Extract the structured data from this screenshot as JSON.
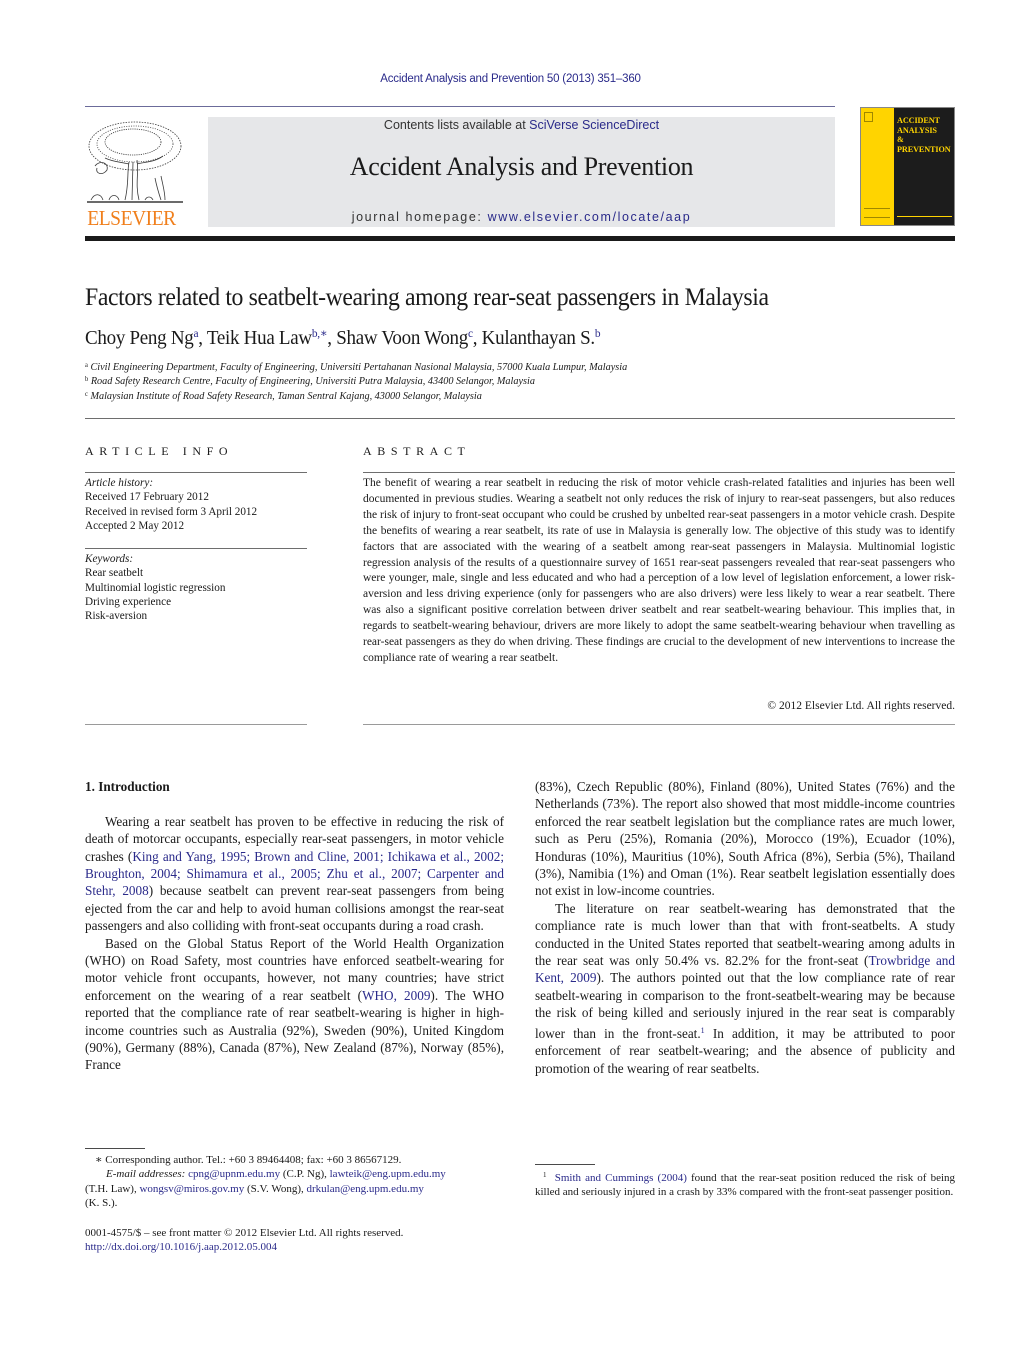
{
  "running_head": "Accident Analysis and Prevention 50 (2013) 351–360",
  "masthead": {
    "publisher_word": "ELSEVIER",
    "contents_prefix": "Contents lists available at ",
    "contents_link": "SciVerse ScienceDirect",
    "journal_title": "Accident Analysis and Prevention",
    "homepage_prefix": "journal homepage: ",
    "homepage_link": "www.elsevier.com/locate/aap",
    "cover_title_lines": [
      "ACCIDENT",
      "ANALYSIS",
      "&",
      "PREVENTION"
    ],
    "colors": {
      "elsevier_orange": "#f07f1c",
      "cover_yellow": "#ffd400",
      "cover_dark": "#1c1c1c",
      "banner_gray": "#e6e7e9",
      "link_blue": "#2a2a8a"
    }
  },
  "article": {
    "title": "Factors related to seatbelt-wearing among rear-seat passengers in Malaysia",
    "authors": [
      {
        "name": "Choy Peng Ng",
        "sup": "a"
      },
      {
        "name": "Teik Hua Law",
        "sup": "b,∗"
      },
      {
        "name": "Shaw Voon Wong",
        "sup": "c"
      },
      {
        "name": "Kulanthayan S.",
        "sup": "b"
      }
    ],
    "affiliations": [
      {
        "key": "a",
        "text": "Civil Engineering Department, Faculty of Engineering, Universiti Pertahanan Nasional Malaysia, 57000 Kuala Lumpur, Malaysia"
      },
      {
        "key": "b",
        "text": "Road Safety Research Centre, Faculty of Engineering, Universiti Putra Malaysia, 43400 Selangor, Malaysia"
      },
      {
        "key": "c",
        "text": "Malaysian Institute of Road Safety Research, Taman Sentral Kajang, 43000 Selangor, Malaysia"
      }
    ]
  },
  "article_info": {
    "heading": "ARTICLE INFO",
    "history_label": "Article history:",
    "history": [
      "Received 17 February 2012",
      "Received in revised form 3 April 2012",
      "Accepted 2 May 2012"
    ],
    "keywords_label": "Keywords:",
    "keywords": [
      "Rear seatbelt",
      "Multinomial logistic regression",
      "Driving experience",
      "Risk-aversion"
    ]
  },
  "abstract": {
    "heading": "ABSTRACT",
    "text": "The benefit of wearing a rear seatbelt in reducing the risk of motor vehicle crash-related fatalities and injuries has been well documented in previous studies. Wearing a seatbelt not only reduces the risk of injury to rear-seat passengers, but also reduces the risk of injury to front-seat occupant who could be crushed by unbelted rear-seat passengers in a motor vehicle crash. Despite the benefits of wearing a rear seatbelt, its rate of use in Malaysia is generally low. The objective of this study was to identify factors that are associated with the wearing of a seatbelt among rear-seat passengers in Malaysia. Multinomial logistic regression analysis of the results of a questionnaire survey of 1651 rear-seat passengers revealed that rear-seat passengers who were younger, male, single and less educated and who had a perception of a low level of legislation enforcement, a lower risk-aversion and less driving experience (only for passengers who are also drivers) were less likely to wear a rear seatbelt. There was also a significant positive correlation between driver seatbelt and rear seatbelt-wearing behaviour. This implies that, in regards to seatbelt-wearing behaviour, drivers are more likely to adopt the same seatbelt-wearing behaviour when travelling as rear-seat passengers as they do when driving. These findings are crucial to the development of new interventions to increase the compliance rate of wearing a rear seatbelt.",
    "copyright": "© 2012 Elsevier Ltd. All rights reserved."
  },
  "body": {
    "section_heading": "1.  Introduction",
    "p1_a": "Wearing a rear seatbelt has proven to be effective in reducing the risk of death of motorcar occupants, especially rear-seat passengers, in motor vehicle crashes (",
    "p1_cite": "King and Yang, 1995; Brown and Cline, 2001; Ichikawa et al., 2002; Broughton, 2004; Shimamura et al., 2005; Zhu et al., 2007; Carpenter and Stehr, 2008",
    "p1_b": ") because seatbelt can prevent rear-seat passengers from being ejected from the car and help to avoid human collisions amongst the rear-seat passengers and also colliding with front-seat occupants during a road crash.",
    "p2_a": "Based on the Global Status Report of the World Health Organization (WHO) on Road Safety, most countries have enforced seatbelt-wearing for motor vehicle front occupants, however, not many countries; have strict enforcement on the wearing of a rear seatbelt (",
    "p2_cite": "WHO, 2009",
    "p2_b": "). The WHO reported that the compliance rate of rear seatbelt-wearing is higher in high-income countries such as Australia (92%), Sweden (90%), United Kingdom (90%), Germany (88%), Canada (87%), New Zealand (87%), Norway (85%), France",
    "p2_cont": "(83%), Czech Republic (80%), Finland (80%), United States (76%) and the Netherlands (73%). The report also showed that most middle-income countries enforced the rear seatbelt legislation but the compliance rates are much lower, such as Peru (25%), Romania (20%), Morocco (19%), Ecuador (10%), Honduras (10%), Mauritius (10%), South Africa (8%), Serbia (5%), Thailand (3%), Namibia (1%) and Oman (1%). Rear seatbelt legislation essentially does not exist in low-income countries.",
    "p3_a": "The literature on rear seatbelt-wearing has demonstrated that the compliance rate is much lower than that with front-seatbelts. A study conducted in the United States reported that seatbelt-wearing among adults in the rear seat was only 50.4% vs. 82.2% for the front-seat (",
    "p3_cite": "Trowbridge and Kent, 2009",
    "p3_b": "). The authors pointed out that the low compliance rate of rear seatbelt-wearing in comparison to the front-seatbelt-wearing may be because the risk of being killed and seriously injured in the rear seat is comparably lower than in the front-seat.",
    "p3_fnref": "1",
    "p3_c": " In addition, it may be attributed to poor enforcement of rear seatbelt-wearing; and the absence of publicity and promotion of the wearing of rear seatbelts."
  },
  "footnotes": {
    "corresponding": "∗  Corresponding author. Tel.: +60 3 89464408; fax: +60 3 86567129.",
    "email_label": "E-mail addresses:",
    "emails": [
      {
        "address": "cpng@upnm.edu.my",
        "who": "(C.P. Ng),"
      },
      {
        "address": "lawteik@eng.upm.edu.my",
        "who": "(T.H. Law),"
      },
      {
        "address": "wongsv@miros.gov.my",
        "who": "(S.V. Wong),"
      },
      {
        "address": "drkulan@eng.upm.edu.my",
        "who": "(K. S.)."
      }
    ],
    "front_matter": "0001-4575/$ – see front matter © 2012 Elsevier Ltd. All rights reserved.",
    "doi": "http://dx.doi.org/10.1016/j.aap.2012.05.004",
    "fn1_mark": "1",
    "fn1_cite": "Smith and Cummings (2004)",
    "fn1_text": " found that the rear-seat position reduced the risk of being killed and seriously injured in a crash by 33% compared with the front-seat passenger position."
  }
}
